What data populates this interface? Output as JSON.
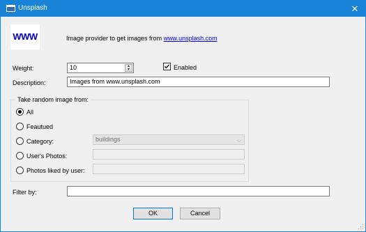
{
  "window": {
    "title": "Unsplash",
    "close_glyph": "✕"
  },
  "header": {
    "logo_text": "WWW",
    "description_prefix": "Image provider to get images from ",
    "link_text": "www.unsplash.com"
  },
  "form": {
    "weight_label": "Weight:",
    "weight_value": "10",
    "enabled_label": "Enabled",
    "enabled_checked": true,
    "description_label": "Description:",
    "description_value": "Images from www.unsplash.com",
    "filter_label": "Filter by:",
    "filter_value": ""
  },
  "random_group": {
    "title": "Take random image from:",
    "options": [
      {
        "label": "All",
        "selected": true
      },
      {
        "label": "Feautued",
        "selected": false
      },
      {
        "label": "Category:",
        "selected": false
      },
      {
        "label": "User's Photos:",
        "selected": false
      },
      {
        "label": "Photos liked by user:",
        "selected": false
      }
    ],
    "category_value": "buildings",
    "users_photos_value": "",
    "liked_by_value": ""
  },
  "buttons": {
    "ok": "OK",
    "cancel": "Cancel"
  },
  "colors": {
    "titlebar": "#1883d7",
    "link": "#0000ee",
    "logo": "#0000c8"
  },
  "icons": {
    "app": "window-icon",
    "close": "close-icon",
    "check": "checkmark-icon",
    "dropdown": "chevron-down-icon",
    "resize": "resize-grip-icon"
  }
}
